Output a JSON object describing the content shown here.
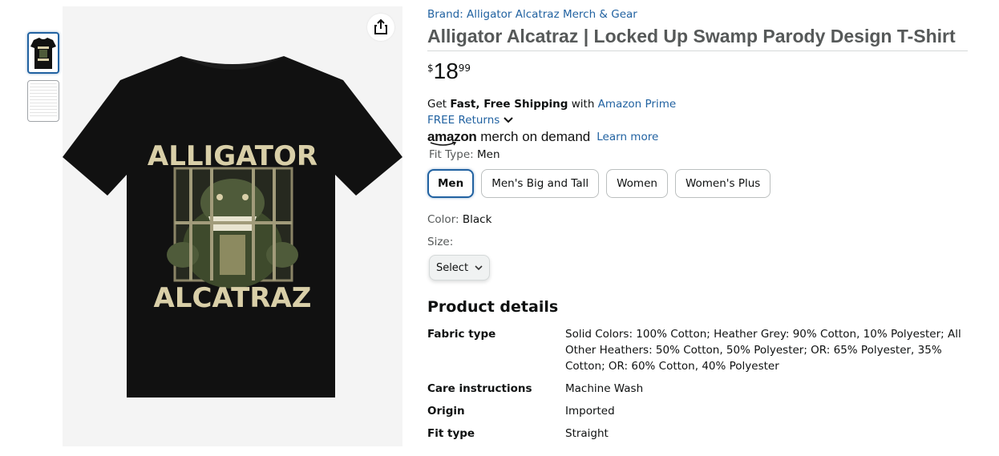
{
  "thumbnails": [
    {
      "name": "tshirt-front-thumbnail",
      "selected": true
    },
    {
      "name": "size-chart-thumbnail",
      "selected": false
    }
  ],
  "product_image": {
    "shirt_text_top": "ALLIGATOR",
    "shirt_text_bottom": "ALCATRAZ"
  },
  "brand_label": "Brand: Alligator Alcatraz Merch & Gear",
  "title": "Alligator Alcatraz | Locked Up Swamp Parody Design T-Shirt",
  "price": {
    "symbol": "$",
    "whole": "18",
    "fraction": "99"
  },
  "shipping": {
    "prefix": "Get ",
    "bold": "Fast, Free Shipping",
    "middle": " with ",
    "link": "Amazon Prime"
  },
  "returns_label": "FREE Returns",
  "merch": {
    "logo_amazon": "amazon",
    "logo_rest": "merch on demand",
    "learn_more": "Learn more"
  },
  "fit_type": {
    "label": "Fit Type:",
    "value": "Men",
    "options": [
      "Men",
      "Men's Big and Tall",
      "Women",
      "Women's Plus"
    ],
    "selected_index": 0
  },
  "color": {
    "label": "Color:",
    "value": "Black"
  },
  "size": {
    "label": "Size:",
    "select_label": "Select"
  },
  "product_details": {
    "heading": "Product details",
    "rows": [
      {
        "key": "Fabric type",
        "value": "Solid Colors: 100% Cotton; Heather Grey: 90% Cotton, 10% Polyester; All Other Heathers: 50% Cotton, 50% Polyester; OR: 65% Polyester, 35% Cotton; OR: 60% Cotton, 40% Polyester"
      },
      {
        "key": "Care instructions",
        "value": "Machine Wash"
      },
      {
        "key": "Origin",
        "value": "Imported"
      },
      {
        "key": "Fit type",
        "value": "Straight"
      }
    ]
  },
  "colors": {
    "link": "#2162a1",
    "selected_border": "#2162a1",
    "shirt": "#111111",
    "print_cream": "#d9cfa8",
    "gator_green": "#4f5b3a"
  }
}
